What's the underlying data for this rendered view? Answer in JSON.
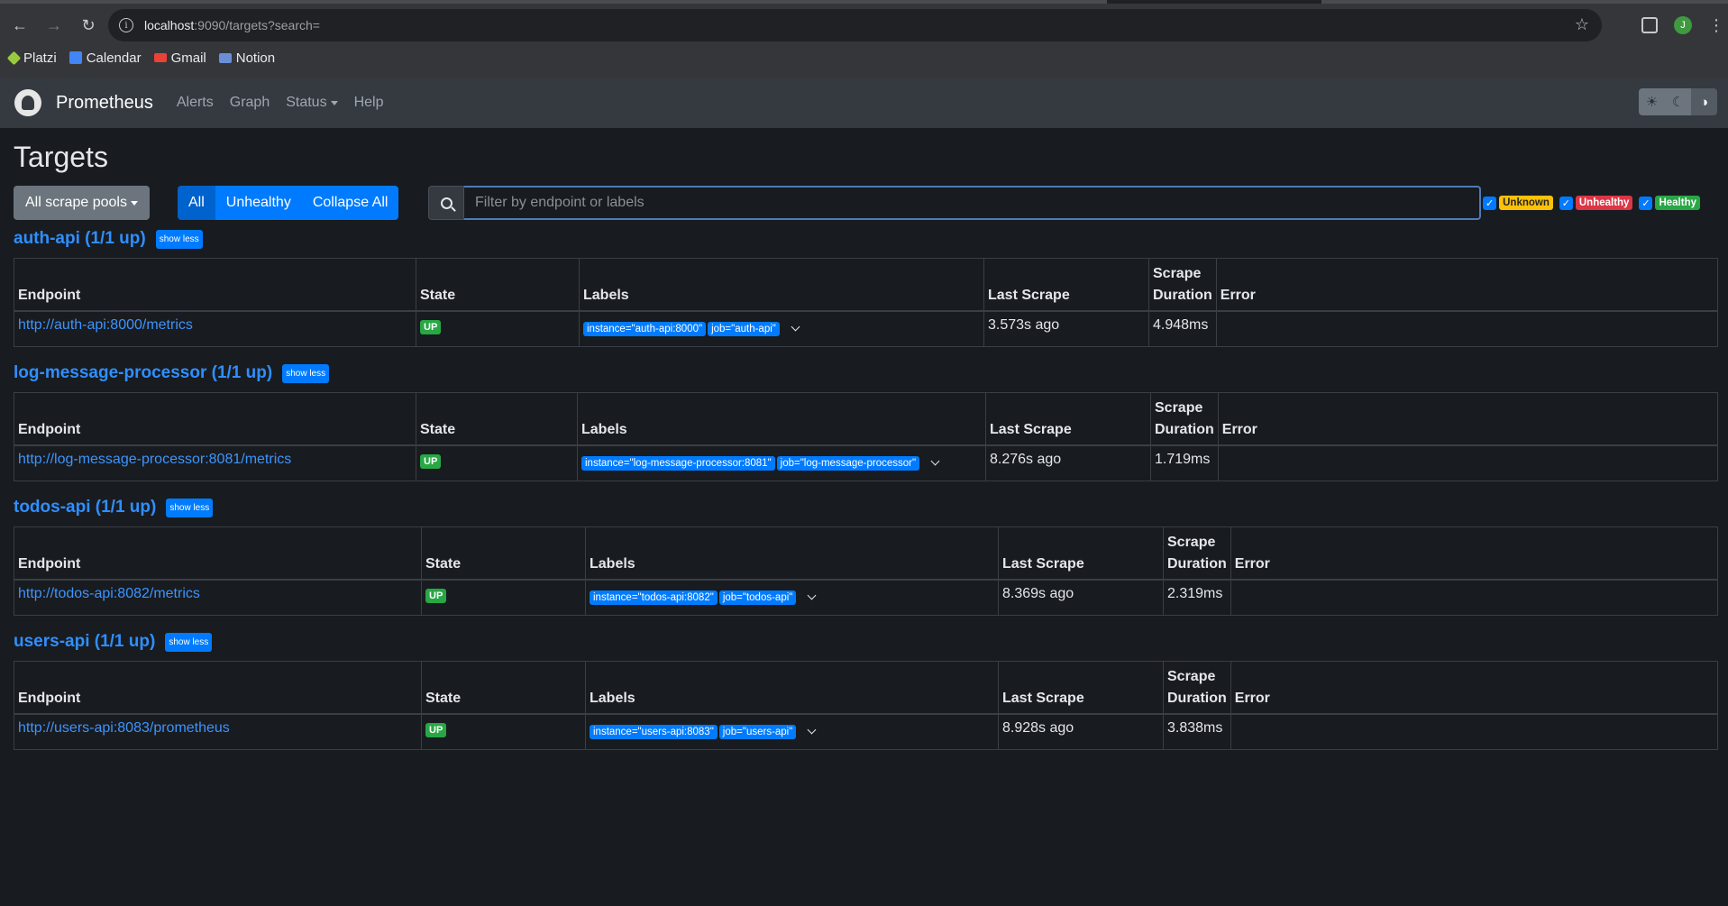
{
  "browser": {
    "url_host": "localhost",
    "url_path": ":9090/targets?search=",
    "avatar_initial": "J",
    "bookmarks": [
      {
        "label": "Platzi",
        "icon": "platzi-icon",
        "color": "#98ca3f"
      },
      {
        "label": "Calendar",
        "icon": "calendar-icon",
        "color": "#4285f4"
      },
      {
        "label": "Gmail",
        "icon": "gmail-icon",
        "color": "#ea4335"
      },
      {
        "label": "Notion",
        "icon": "notion-icon",
        "color": "#6b8fd6"
      }
    ]
  },
  "navbar": {
    "brand": "Prometheus",
    "links": [
      "Alerts",
      "Graph",
      "Status",
      "Help"
    ]
  },
  "page": {
    "title": "Targets",
    "pools_button": "All scrape pools",
    "filter_buttons": [
      "All",
      "Unhealthy",
      "Collapse All"
    ],
    "search_placeholder": "Filter by endpoint or labels",
    "health_filters": [
      "Unknown",
      "Unhealthy",
      "Healthy"
    ]
  },
  "table_headers": {
    "endpoint": "Endpoint",
    "state": "State",
    "labels": "Labels",
    "last_scrape": "Last Scrape",
    "scrape_duration_1": "Scrape",
    "scrape_duration_2": "Duration",
    "error": "Error"
  },
  "pools": [
    {
      "title": "auth-api (1/1 up)",
      "toggle": "show less",
      "endpoint": "http://auth-api:8000/metrics",
      "state": "UP",
      "labels": [
        "instance=\"auth-api:8000\"",
        "job=\"auth-api\""
      ],
      "last_scrape": "3.573s ago",
      "duration": "4.948ms",
      "error": ""
    },
    {
      "title": "log-message-processor (1/1 up)",
      "toggle": "show less",
      "endpoint": "http://log-message-processor:8081/metrics",
      "state": "UP",
      "labels": [
        "instance=\"log-message-processor:8081\"",
        "job=\"log-message-processor\""
      ],
      "last_scrape": "8.276s ago",
      "duration": "1.719ms",
      "error": ""
    },
    {
      "title": "todos-api (1/1 up)",
      "toggle": "show less",
      "endpoint": "http://todos-api:8082/metrics",
      "state": "UP",
      "labels": [
        "instance=\"todos-api:8082\"",
        "job=\"todos-api\""
      ],
      "last_scrape": "8.369s ago",
      "duration": "2.319ms",
      "error": ""
    },
    {
      "title": "users-api (1/1 up)",
      "toggle": "show less",
      "endpoint": "http://users-api:8083/prometheus",
      "state": "UP",
      "labels": [
        "instance=\"users-api:8083\"",
        "job=\"users-api\""
      ],
      "last_scrape": "8.928s ago",
      "duration": "3.838ms",
      "error": ""
    }
  ]
}
